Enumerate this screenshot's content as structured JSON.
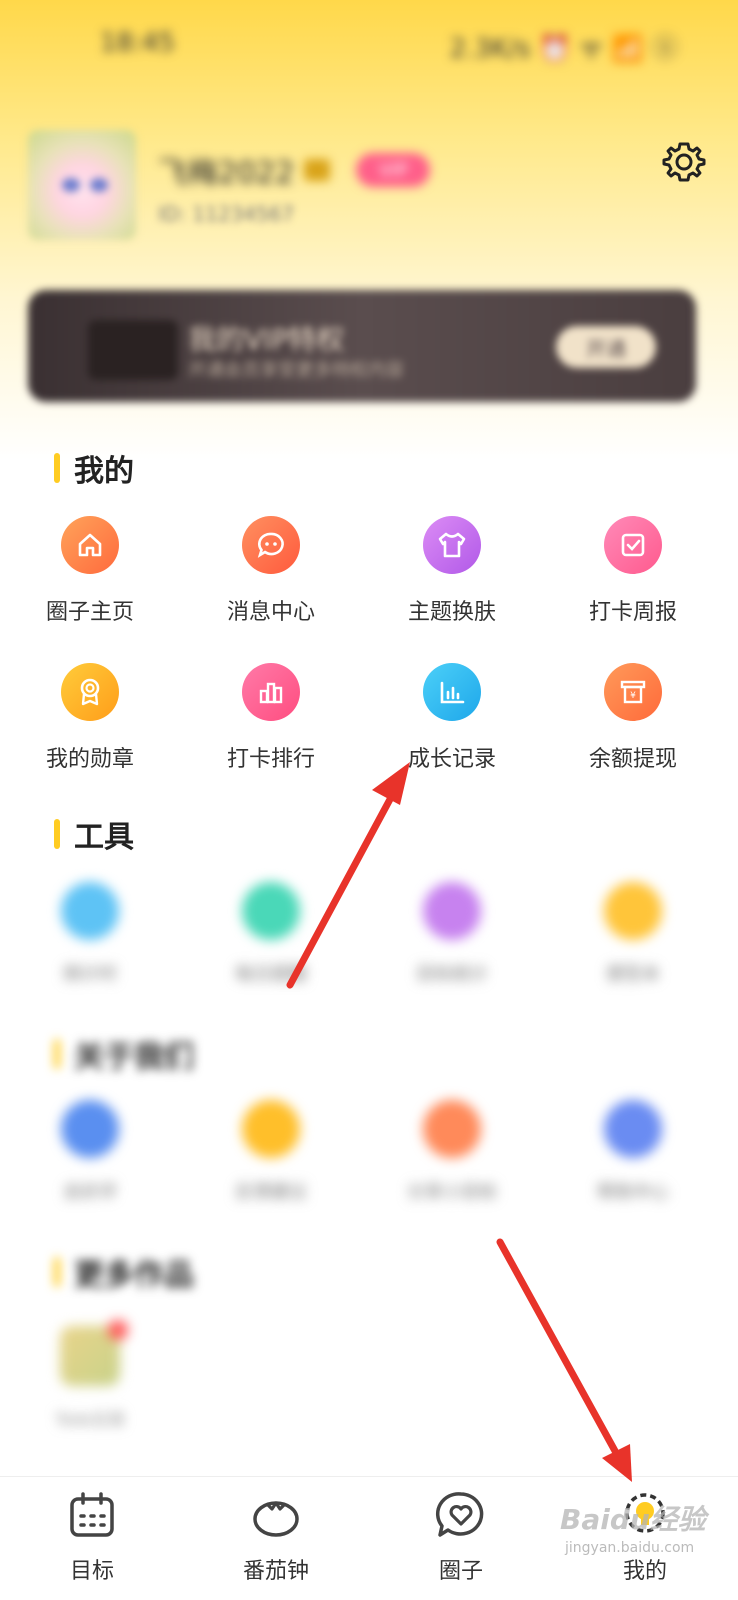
{
  "status_bar": {
    "time": "18:45",
    "right": "2.3K/s ⏰ ᯤ 📶 ⓢ"
  },
  "profile": {
    "nickname": "飞梅2022",
    "vip_badge": "VIP",
    "uid": "ID: 11234567"
  },
  "vip_card": {
    "title": "我的VIP特权",
    "subtitle": "开通会员享受更多特权内容",
    "button": "开通"
  },
  "sections": {
    "mine": {
      "title": "我的"
    },
    "tools": {
      "title": "工具"
    },
    "about": {
      "title": "关于我们"
    },
    "more": {
      "title": "更多作品"
    }
  },
  "mine_items": [
    {
      "label": "圈子主页",
      "icon": "home-icon",
      "color": "#ff7a4a"
    },
    {
      "label": "消息中心",
      "icon": "message-icon",
      "color": "#ff6b4a"
    },
    {
      "label": "主题换肤",
      "icon": "shirt-icon",
      "color": "#c867ee"
    },
    {
      "label": "打卡周报",
      "icon": "checklist-icon",
      "color": "#ff6aa0"
    },
    {
      "label": "我的勋章",
      "icon": "medal-icon",
      "color": "#ffb11a"
    },
    {
      "label": "打卡排行",
      "icon": "ranking-icon",
      "color": "#ff5d8f"
    },
    {
      "label": "成长记录",
      "icon": "chart-icon",
      "color": "#2bb6f0"
    },
    {
      "label": "余额提现",
      "icon": "withdraw-icon",
      "color": "#ff7c4a"
    }
  ],
  "tool_items": [
    {
      "label": "倒计时",
      "color": "#5ec3f5"
    },
    {
      "label": "每日提醒",
      "color": "#4ad8b8"
    },
    {
      "label": "目标统计",
      "color": "#c782ef"
    },
    {
      "label": "便签本",
      "color": "#ffc53a"
    }
  ],
  "about_items": [
    {
      "label": "去好评",
      "color": "#5a8ff0"
    },
    {
      "label": "反馈建议",
      "color": "#ffbf2a"
    },
    {
      "label": "分享小目标",
      "color": "#ff8a5a"
    },
    {
      "label": "帮助中心",
      "color": "#6a8cf2"
    }
  ],
  "more_items": [
    {
      "label": "Todo日清"
    }
  ],
  "tabs": [
    {
      "label": "目标",
      "icon": "calendar-icon"
    },
    {
      "label": "番茄钟",
      "icon": "tomato-icon"
    },
    {
      "label": "圈子",
      "icon": "heart-bubble-icon"
    },
    {
      "label": "我的",
      "icon": "bulb-icon"
    }
  ],
  "watermark": {
    "text": "Baidu经验",
    "sub": "jingyan.baidu.com"
  },
  "colors": {
    "accent": "#ffcc22",
    "arrow": "#e8332a"
  }
}
